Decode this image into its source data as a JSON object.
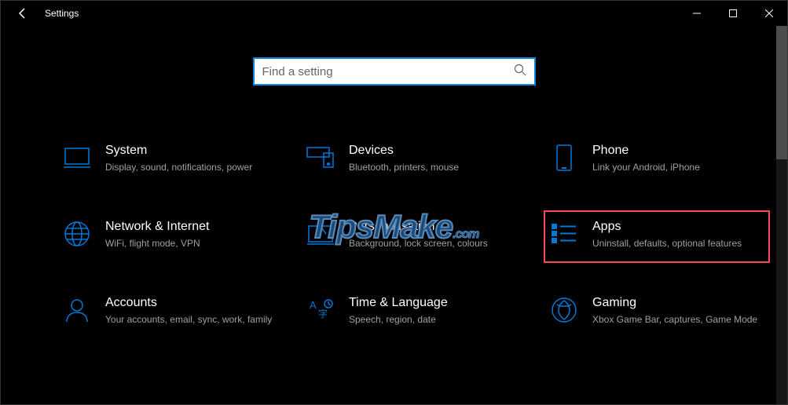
{
  "window": {
    "title": "Settings"
  },
  "search": {
    "placeholder": "Find a setting"
  },
  "tiles": {
    "system": {
      "title": "System",
      "desc": "Display, sound, notifications, power"
    },
    "devices": {
      "title": "Devices",
      "desc": "Bluetooth, printers, mouse"
    },
    "phone": {
      "title": "Phone",
      "desc": "Link your Android, iPhone"
    },
    "network": {
      "title": "Network & Internet",
      "desc": "WiFi, flight mode, VPN"
    },
    "personal": {
      "title": "Personalisation",
      "desc": "Background, lock screen, colours"
    },
    "apps": {
      "title": "Apps",
      "desc": "Uninstall, defaults, optional features"
    },
    "accounts": {
      "title": "Accounts",
      "desc": "Your accounts, email, sync, work, family"
    },
    "time": {
      "title": "Time & Language",
      "desc": "Speech, region, date"
    },
    "gaming": {
      "title": "Gaming",
      "desc": "Xbox Game Bar, captures, Game Mode"
    }
  },
  "watermark": "TipsMake",
  "watermark_suffix": ".com"
}
